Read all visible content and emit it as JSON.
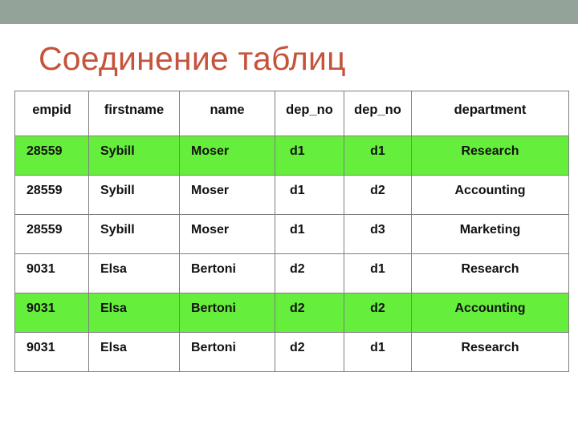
{
  "slide": {
    "title": "Соединение таблиц",
    "title_color": "#c5543c",
    "top_band_color": "#93a399",
    "background_color": "#ffffff"
  },
  "table": {
    "highlight_color": "#66ee3c",
    "border_color": "#7f7f7f",
    "columns": [
      {
        "key": "empid",
        "label": "empid"
      },
      {
        "key": "firstname",
        "label": "firstname"
      },
      {
        "key": "name",
        "label": "name"
      },
      {
        "key": "depno1",
        "label": "dep_no"
      },
      {
        "key": "depno2",
        "label": "dep_no"
      },
      {
        "key": "department",
        "label": "department"
      }
    ],
    "rows": [
      {
        "highlighted": true,
        "cells": [
          "28559",
          "Sybill",
          "Moser",
          "d1",
          "d1",
          "Research"
        ]
      },
      {
        "highlighted": false,
        "cells": [
          "28559",
          "Sybill",
          "Moser",
          "d1",
          "d2",
          "Accounting"
        ]
      },
      {
        "highlighted": false,
        "cells": [
          "28559",
          "Sybill",
          "Moser",
          "d1",
          "d3",
          "Marketing"
        ]
      },
      {
        "highlighted": false,
        "cells": [
          "9031",
          "Elsa",
          "Bertoni",
          "d2",
          "d1",
          "Research"
        ]
      },
      {
        "highlighted": true,
        "cells": [
          "9031",
          "Elsa",
          "Bertoni",
          "d2",
          "d2",
          "Accounting"
        ]
      },
      {
        "highlighted": false,
        "cells": [
          "9031",
          "Elsa",
          "Bertoni",
          "d2",
          "d1",
          "Research"
        ]
      }
    ]
  }
}
